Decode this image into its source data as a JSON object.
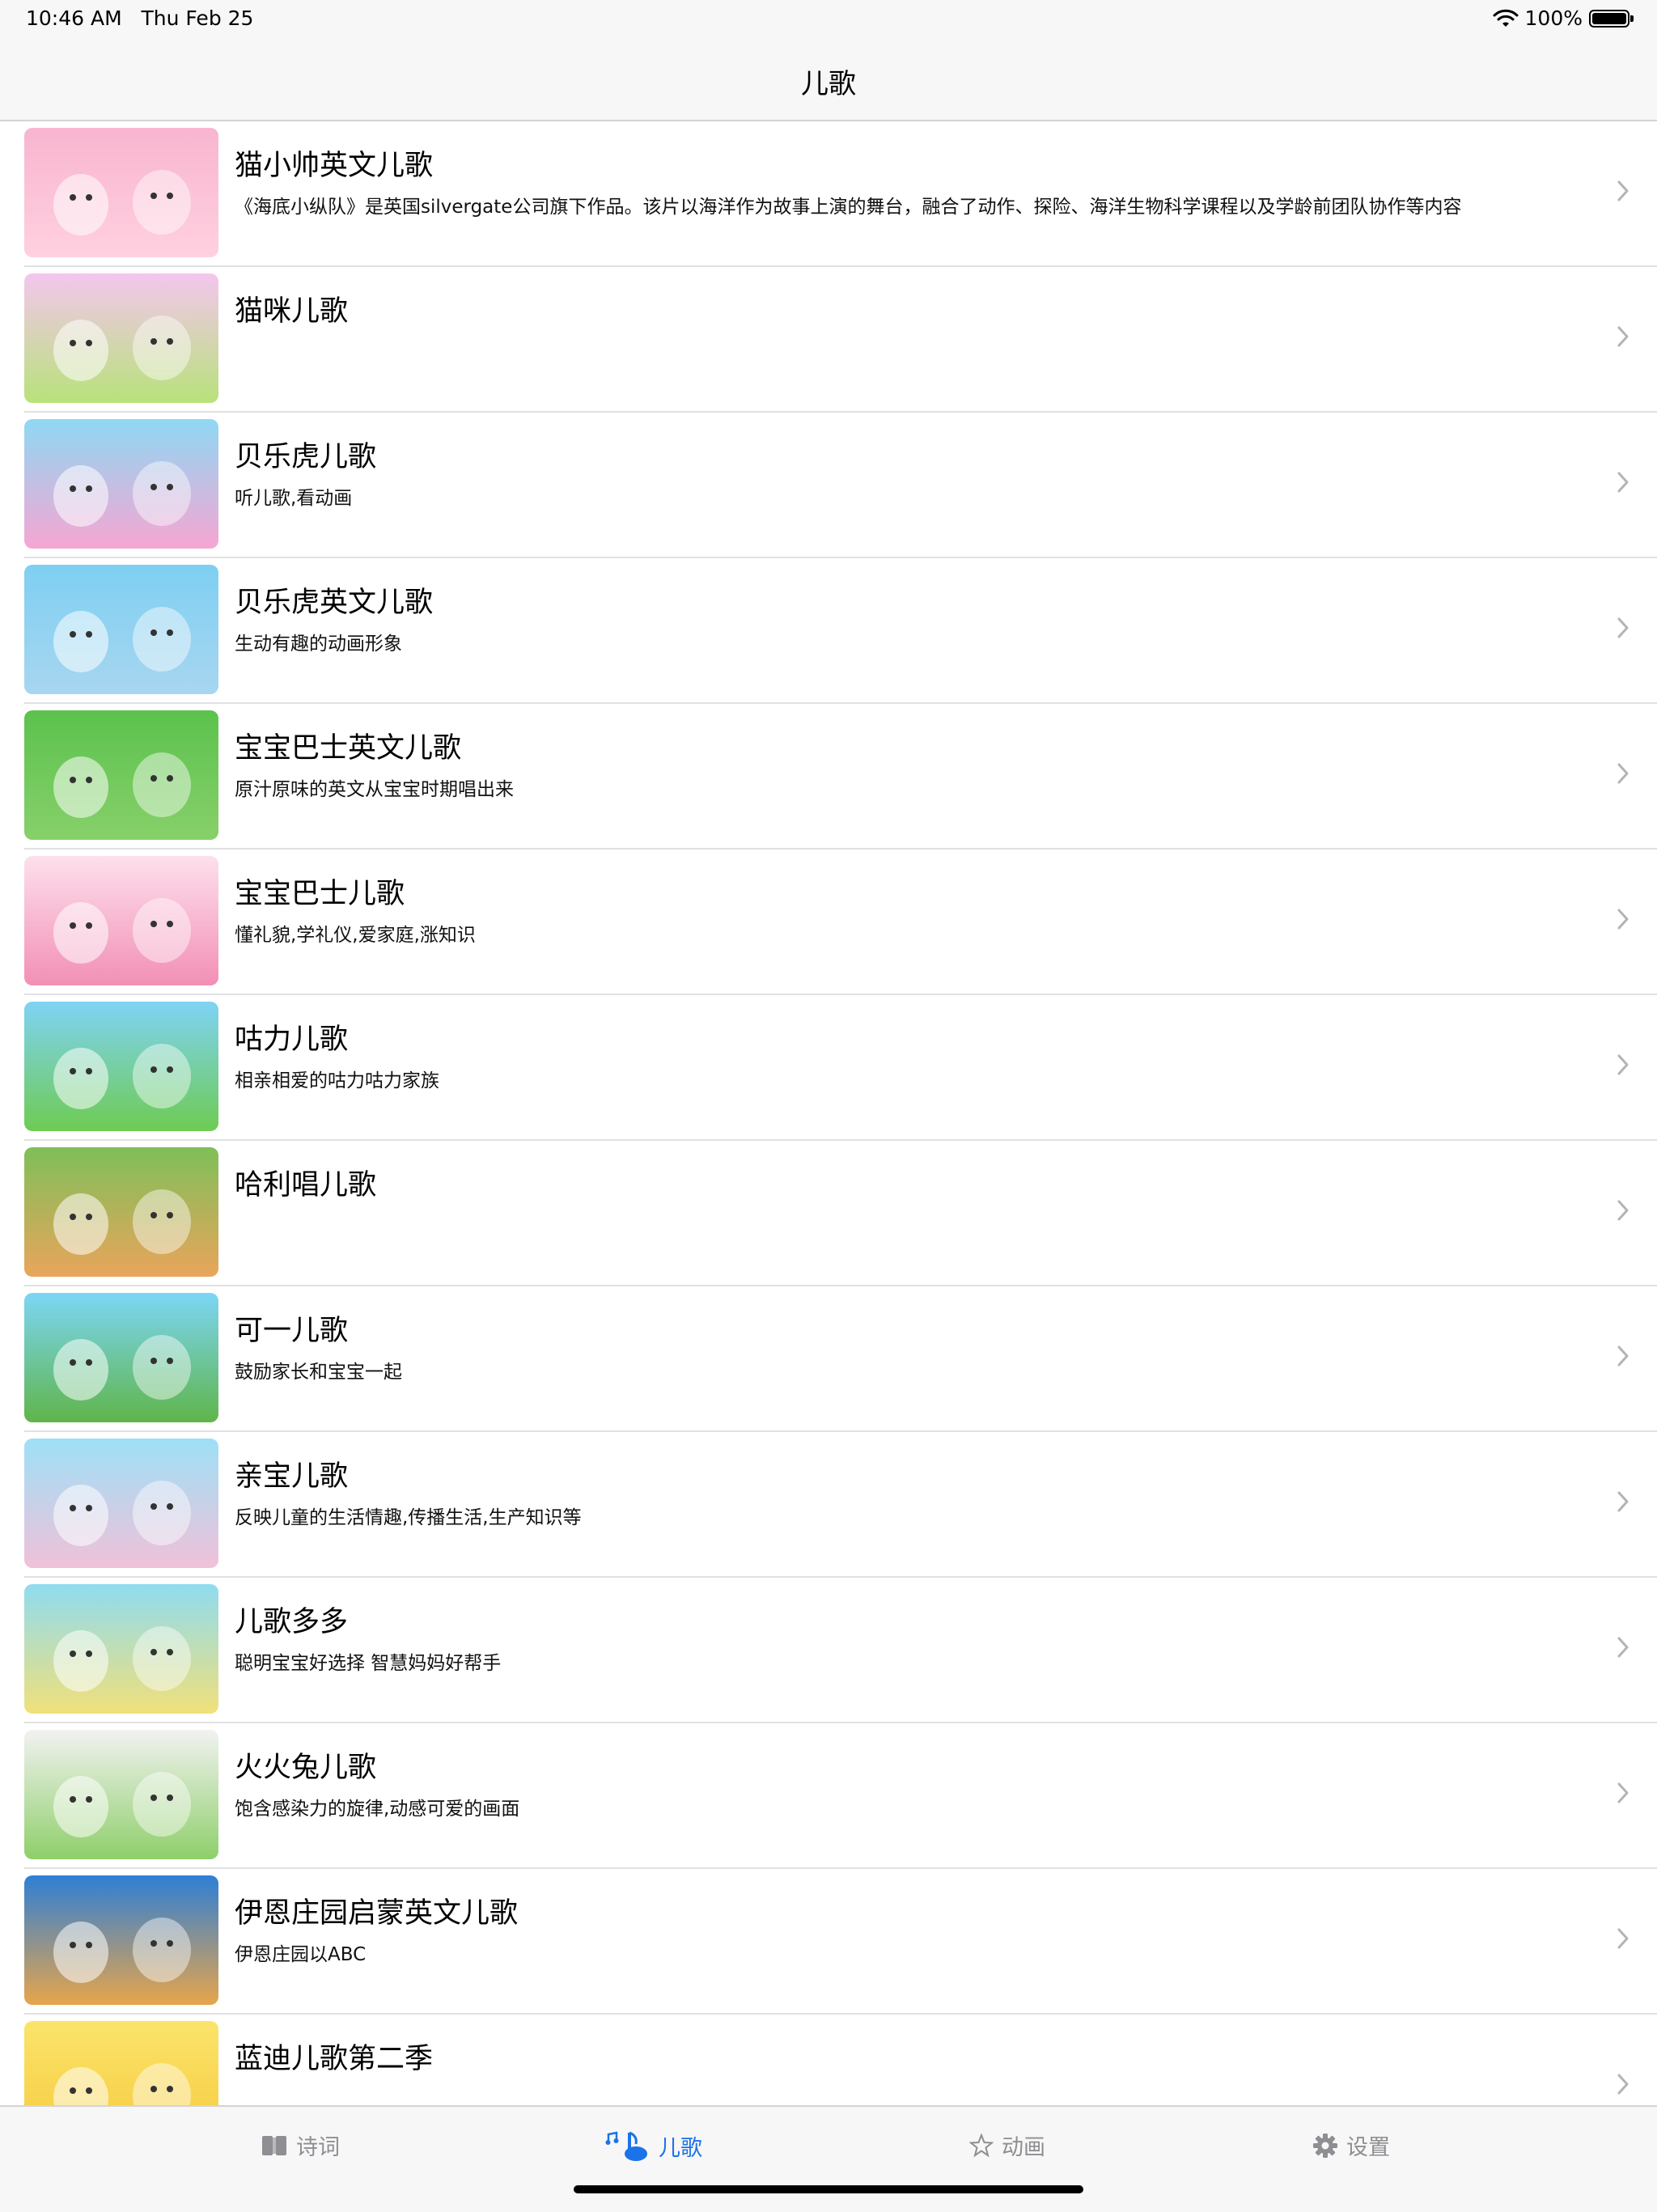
{
  "status": {
    "time": "10:46 AM",
    "date": "Thu Feb 25",
    "battery": "100%"
  },
  "nav": {
    "title": "儿歌"
  },
  "list": [
    {
      "title": "猫小帅英文儿歌",
      "subtitle": "《海底小纵队》是英国silvergate公司旗下作品。该片以海洋作为故事上演的舞台，融合了动作、探险、海洋生物科学课程以及学龄前团队协作等内容",
      "thumb": [
        "#f8b5cf",
        "#ffd0e0"
      ]
    },
    {
      "title": "猫咪儿歌",
      "subtitle": "",
      "thumb": [
        "#f4c6ee",
        "#b8e27a"
      ]
    },
    {
      "title": "贝乐虎儿歌",
      "subtitle": "听儿歌,看动画",
      "thumb": [
        "#8fd8f4",
        "#f6a6d2"
      ]
    },
    {
      "title": "贝乐虎英文儿歌",
      "subtitle": "生动有趣的动画形象",
      "thumb": [
        "#7ecff2",
        "#a8d6f0"
      ]
    },
    {
      "title": "宝宝巴士英文儿歌",
      "subtitle": "原汁原味的英文从宝宝时期唱出来",
      "thumb": [
        "#5bc24d",
        "#87d06a"
      ]
    },
    {
      "title": "宝宝巴士儿歌",
      "subtitle": "懂礼貌,学礼仪,爱家庭,涨知识",
      "thumb": [
        "#fde0ec",
        "#f28fb5"
      ]
    },
    {
      "title": "咕力儿歌",
      "subtitle": "相亲相爱的咕力咕力家族",
      "thumb": [
        "#7fd3f5",
        "#6ecb52"
      ]
    },
    {
      "title": "哈利唱儿歌",
      "subtitle": "",
      "thumb": [
        "#7fbf59",
        "#e9a55b"
      ]
    },
    {
      "title": "可一儿歌",
      "subtitle": "鼓励家长和宝宝一起",
      "thumb": [
        "#7cd6f5",
        "#5fb54a"
      ]
    },
    {
      "title": "亲宝儿歌",
      "subtitle": "反映儿童的生活情趣,传播生活,生产知识等",
      "thumb": [
        "#9ee0f6",
        "#f0c1d9"
      ]
    },
    {
      "title": "儿歌多多",
      "subtitle": "聪明宝宝好选择 智慧妈妈好帮手",
      "thumb": [
        "#8fdcf0",
        "#f1e07a"
      ]
    },
    {
      "title": "火火兔儿歌",
      "subtitle": "饱含感染力的旋律,动感可爱的画面",
      "thumb": [
        "#f2f2f2",
        "#8fcf6a"
      ]
    },
    {
      "title": "伊恩庄园启蒙英文儿歌",
      "subtitle": "伊恩庄园以ABC",
      "thumb": [
        "#2e7fd6",
        "#e7a54b"
      ]
    },
    {
      "title": "蓝迪儿歌第二季",
      "subtitle": "",
      "thumb": [
        "#fbe46b",
        "#f6c93d"
      ]
    }
  ],
  "tabs": [
    {
      "label": "诗词",
      "icon": "book-icon"
    },
    {
      "label": "儿歌",
      "icon": "music-note-icon"
    },
    {
      "label": "动画",
      "icon": "star-icon"
    },
    {
      "label": "设置",
      "icon": "gear-icon"
    }
  ],
  "colors": {
    "active_tab": "#1a73e8",
    "inactive_tab": "#8e8e93"
  }
}
